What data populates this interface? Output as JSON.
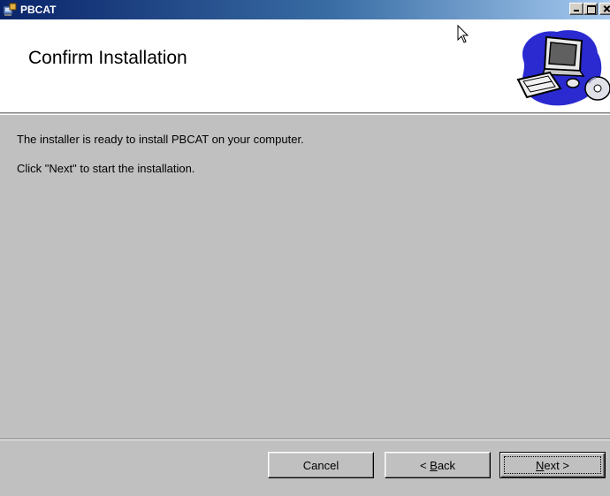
{
  "window": {
    "title": "PBCAT"
  },
  "header": {
    "title": "Confirm Installation"
  },
  "body": {
    "line1": "The installer is ready to install PBCAT on your computer.",
    "line2": "Click \"Next\" to start the installation."
  },
  "buttons": {
    "cancel": "Cancel",
    "back_prefix": "< ",
    "back_accel": "B",
    "back_rest": "ack",
    "next_accel": "N",
    "next_rest": "ext >"
  },
  "colors": {
    "titlebar_start": "#0a246a",
    "titlebar_end": "#a6caf0",
    "dialog_bg": "#c0c0c0",
    "banner_bg": "#ffffff"
  },
  "icons": {
    "title": "installer-icon",
    "banner": "computer-cd-icon",
    "pointer": "mouse-pointer-icon"
  }
}
